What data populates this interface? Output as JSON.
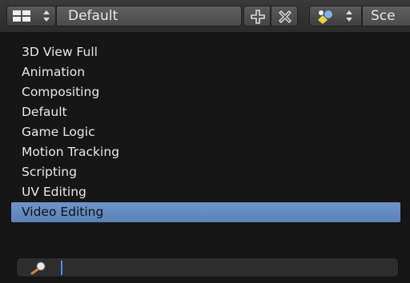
{
  "header": {
    "editor_type_icon": "editor-grid-icon",
    "layout_name": "Default",
    "add_icon": "plus-icon",
    "remove_icon": "x-icon",
    "scene_icon": "scene-icon",
    "scene_name": "Sce"
  },
  "menu": {
    "items": [
      "3D View Full",
      "Animation",
      "Compositing",
      "Default",
      "Game Logic",
      "Motion Tracking",
      "Scripting",
      "UV Editing",
      "Video Editing"
    ],
    "selected": "Video Editing"
  },
  "search": {
    "icon": "magnifier-icon",
    "value": ""
  },
  "colors": {
    "selection": "#6f95c9",
    "caret": "#4a8cff",
    "background": "#161616"
  }
}
